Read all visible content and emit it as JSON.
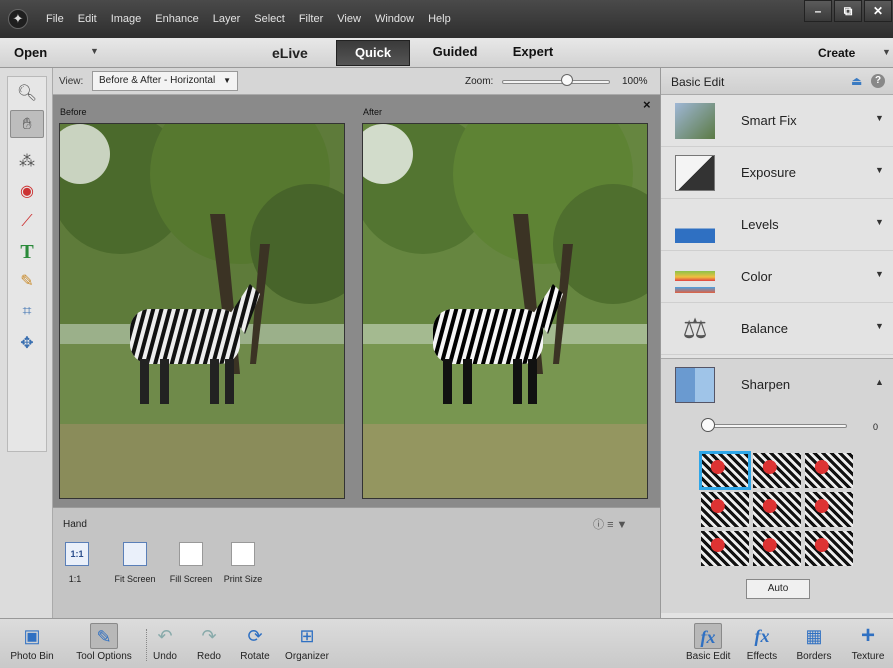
{
  "menubar": {
    "items": [
      "File",
      "Edit",
      "Image",
      "Enhance",
      "Layer",
      "Select",
      "Filter",
      "View",
      "Window",
      "Help"
    ],
    "window_buttons": [
      "–",
      "⧉",
      "✕"
    ]
  },
  "modebar": {
    "open": "Open",
    "elive": "eLive",
    "tabs": [
      "Quick",
      "Guided",
      "Expert"
    ],
    "create": "Create"
  },
  "viewbar": {
    "view_label": "View:",
    "view_value": "Before & After - Horizontal",
    "zoom_label": "Zoom:",
    "zoom_value": "100%",
    "zoom_level": 0.6
  },
  "canvas": {
    "before_label": "Before",
    "after_label": "After",
    "close": "×"
  },
  "tool_options": {
    "title": "Hand",
    "buttons": [
      {
        "icon": "1:1",
        "label": "1:1"
      },
      {
        "icon": "",
        "label": "Fit Screen"
      },
      {
        "icon": "",
        "label": "Fill Screen"
      },
      {
        "icon": "",
        "label": "Print Size"
      }
    ]
  },
  "panel": {
    "title": "Basic Edit",
    "rows": [
      {
        "label": "Smart Fix",
        "icon": "smart-fix-icon"
      },
      {
        "label": "Exposure",
        "icon": "exposure-icon"
      },
      {
        "label": "Levels",
        "icon": "levels-icon"
      },
      {
        "label": "Color",
        "icon": "color-icon"
      },
      {
        "label": "Balance",
        "icon": "balance-icon"
      }
    ],
    "sharpen": {
      "label": "Sharpen",
      "value": "0",
      "auto": "Auto"
    }
  },
  "bottombar": {
    "left": [
      "Photo Bin",
      "Tool Options",
      "Undo",
      "Redo",
      "Rotate",
      "Organizer"
    ],
    "right": [
      "Basic Edit",
      "Effects",
      "Borders",
      "Texture"
    ]
  },
  "colors": {
    "accent": "#2f70c2",
    "selection": "#2ea6e8"
  }
}
